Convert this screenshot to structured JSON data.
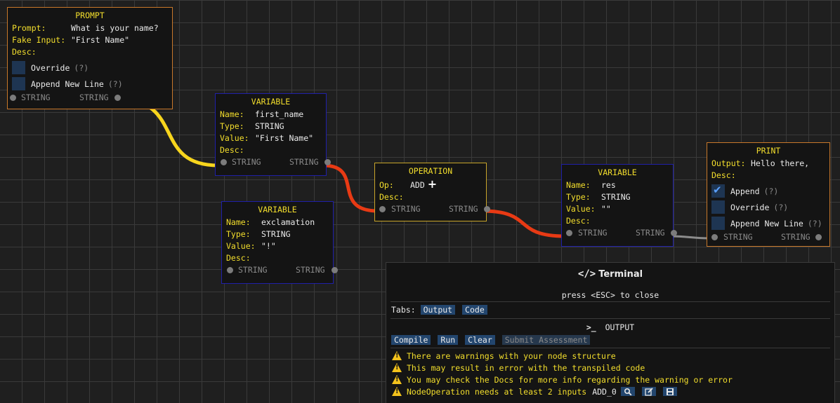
{
  "nodes": {
    "prompt": {
      "title": "PROMPT",
      "prompt_key": "Prompt:",
      "prompt_val": "What is your name?",
      "fake_key": "Fake Input:",
      "fake_val": "\"First Name\"",
      "desc_key": "Desc:",
      "override_label": "Override",
      "override_q": "(?)",
      "append_label": "Append New Line",
      "append_q": "(?)",
      "in_pin": "STRING",
      "out_pin": "STRING"
    },
    "var_first": {
      "title": "VARIABLE",
      "name_key": "Name:",
      "name_val": "first_name",
      "type_key": "Type:",
      "type_val": "STRING",
      "value_key": "Value:",
      "value_val": "\"First Name\"",
      "desc_key": "Desc:",
      "in_pin": "STRING",
      "out_pin": "STRING"
    },
    "var_excl": {
      "title": "VARIABLE",
      "name_key": "Name:",
      "name_val": "exclamation",
      "type_key": "Type:",
      "type_val": "STRING",
      "value_key": "Value:",
      "value_val": "\"!\"",
      "desc_key": "Desc:",
      "in_pin": "STRING",
      "out_pin": "STRING"
    },
    "operation": {
      "title": "OPERATION",
      "op_key": "Op:",
      "op_val": "ADD",
      "desc_key": "Desc:",
      "in_pin": "STRING",
      "out_pin": "STRING"
    },
    "var_res": {
      "title": "VARIABLE",
      "name_key": "Name:",
      "name_val": "res",
      "type_key": "Type:",
      "type_val": "STRING",
      "value_key": "Value:",
      "value_val": "\"\"",
      "desc_key": "Desc:",
      "in_pin": "STRING",
      "out_pin": "STRING"
    },
    "print": {
      "title": "PRINT",
      "output_key": "Output:",
      "output_val": "Hello there,",
      "desc_key": "Desc:",
      "append_label": "Append",
      "append_q": "(?)",
      "append_checked": true,
      "override_label": "Override",
      "override_q": "(?)",
      "newline_label": "Append New Line",
      "newline_q": "(?)",
      "in_pin": "STRING",
      "out_pin": "STRING"
    }
  },
  "wire_colors": {
    "yellow": "#f7d51d",
    "red": "#e83a14",
    "gray": "#8c8c8c"
  },
  "terminal": {
    "title": "Terminal",
    "hint": "press <ESC> to close",
    "tabs_label": "Tabs:",
    "tabs": [
      "Output",
      "Code"
    ],
    "output_label": "OUTPUT",
    "buttons": [
      "Compile",
      "Run",
      "Clear",
      "Submit Assessment"
    ],
    "warnings": [
      "There are warnings with your node structure",
      "This may result in error with the transpiled code",
      "You may check the Docs for more info regarding the warning or error",
      "NodeOperation needs at least 2 inputs"
    ],
    "warning_node": "ADD_0"
  }
}
